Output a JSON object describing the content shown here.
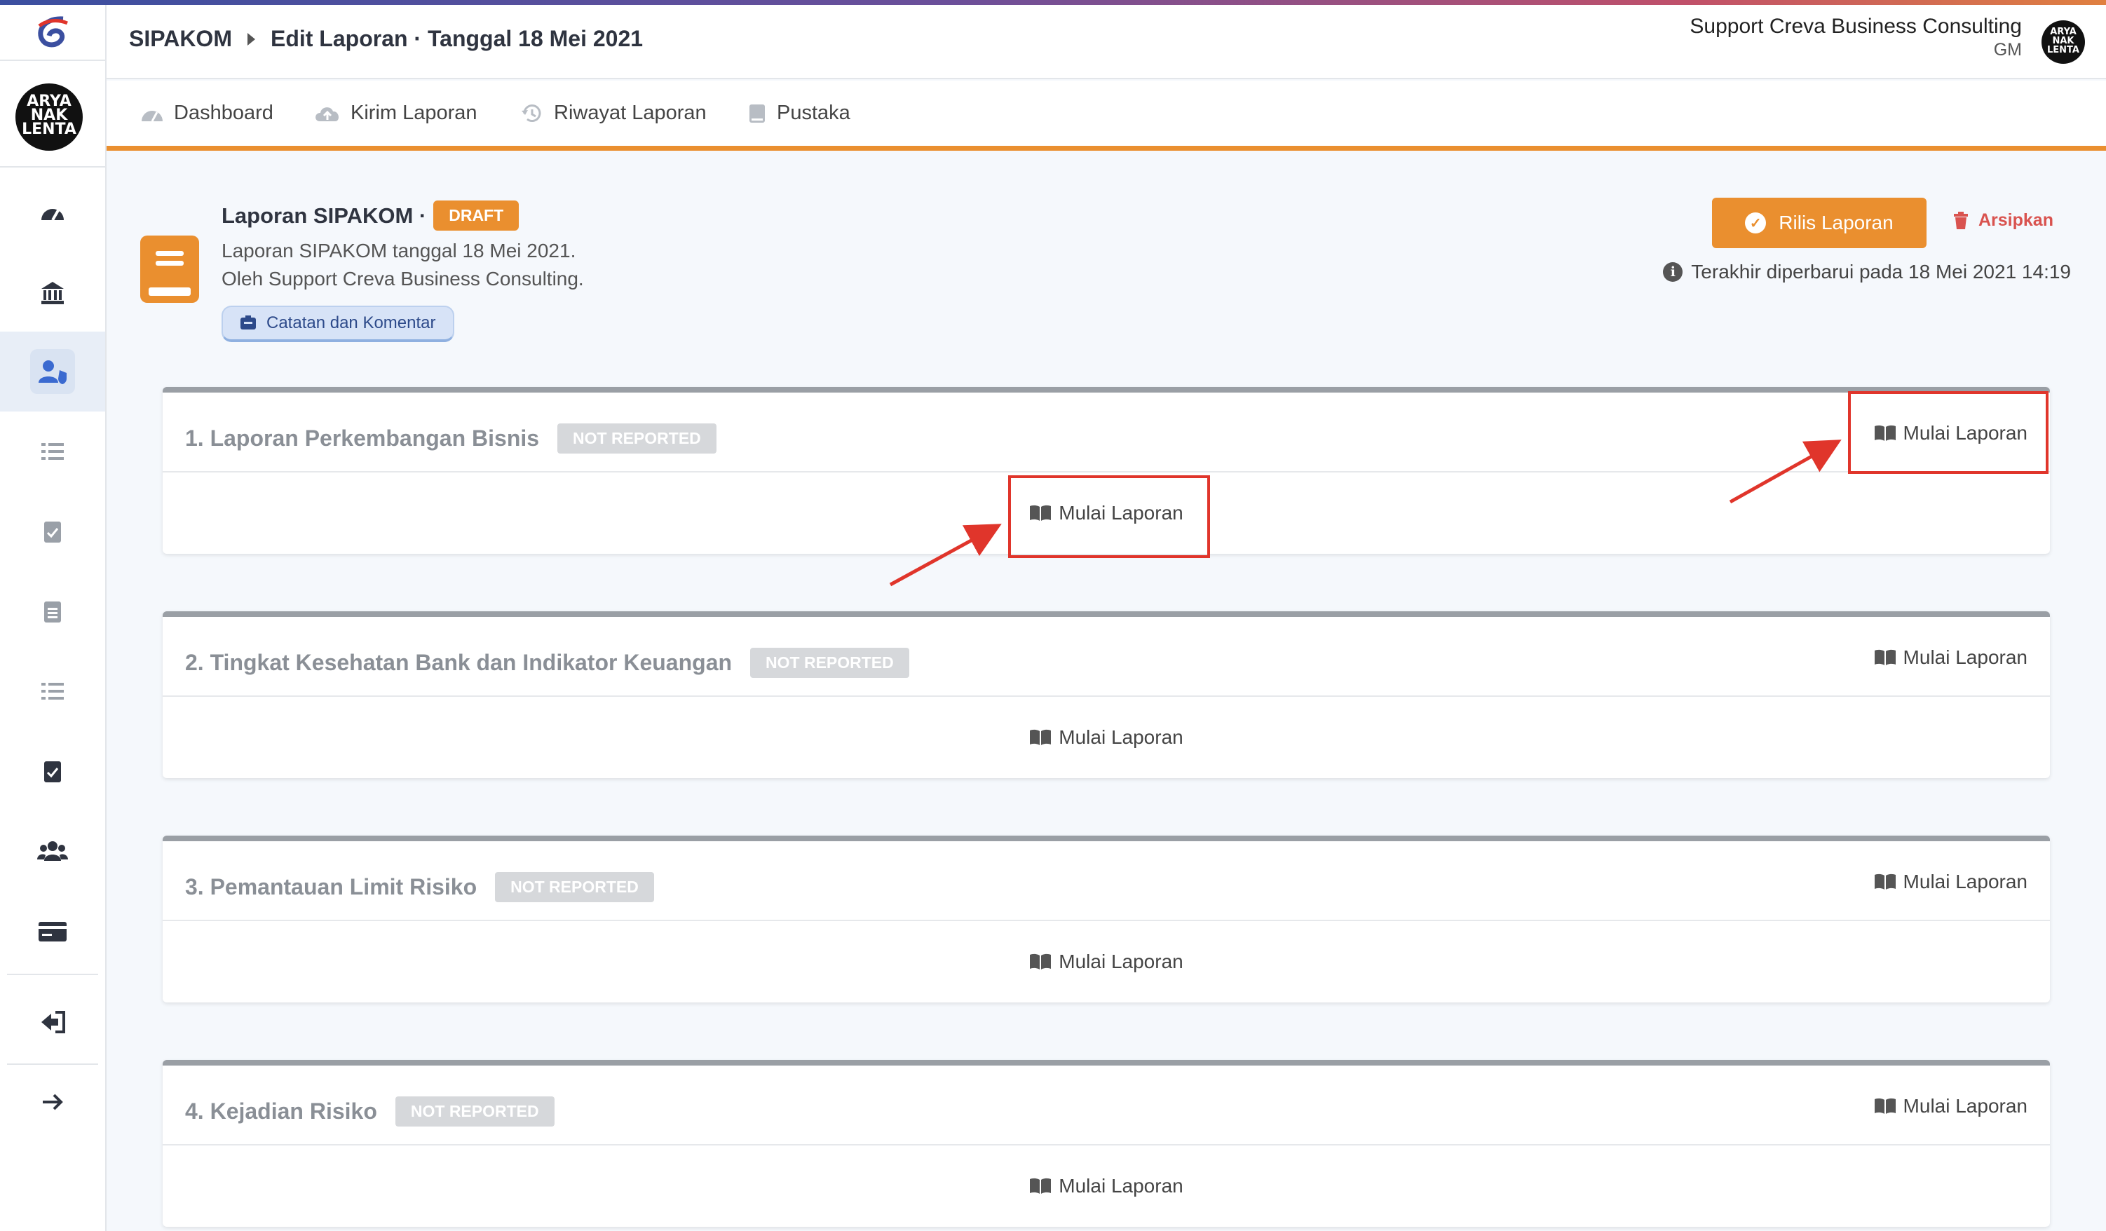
{
  "colors": {
    "accent": "#ea8f2f",
    "danger": "#d9534f",
    "annotation": "#e0352b",
    "badge_muted": "#d6d8db"
  },
  "sidebar": {
    "logo_icon": "app-logo-icon",
    "avatar_text": "ARYA NAK LENTA",
    "items": [
      {
        "name": "dashboard",
        "icon": "tachometer-icon",
        "glyph": "◔"
      },
      {
        "name": "bank",
        "icon": "bank-icon",
        "glyph": "⌂"
      },
      {
        "name": "users",
        "icon": "user-shield-icon",
        "glyph": "●",
        "active": true
      },
      {
        "name": "tasks",
        "icon": "task-list-icon",
        "glyph": "☰"
      },
      {
        "name": "clipboard-check",
        "icon": "clipboard-check-icon",
        "glyph": "✓"
      },
      {
        "name": "clipboard-list",
        "icon": "clipboard-list-icon",
        "glyph": "▤"
      },
      {
        "name": "tasks-2",
        "icon": "task-list-icon",
        "glyph": "☰"
      },
      {
        "name": "clipboard-check-2",
        "icon": "clipboard-check-icon",
        "glyph": "✓"
      },
      {
        "name": "group",
        "icon": "users-group-icon",
        "glyph": "●●"
      },
      {
        "name": "card",
        "icon": "credit-card-icon",
        "glyph": "▭"
      },
      {
        "name": "logout",
        "icon": "sign-out-icon",
        "glyph": "⇦"
      },
      {
        "name": "expand",
        "icon": "arrow-right-icon",
        "glyph": "→"
      }
    ]
  },
  "header": {
    "crumb_root": "SIPAKOM",
    "crumb_page": "Edit Laporan · Tanggal 18 Mei 2021",
    "user_name": "Support Creva Business Consulting",
    "user_role": "GM",
    "user_avatar_text": "ARYA NAK LENTA"
  },
  "tabs": [
    {
      "label": "Dashboard",
      "icon": "dashboard-icon",
      "glyph": "◔"
    },
    {
      "label": "Kirim Laporan",
      "icon": "cloud-upload-icon",
      "glyph": "☁"
    },
    {
      "label": "Riwayat Laporan",
      "icon": "history-icon",
      "glyph": "↺"
    },
    {
      "label": "Pustaka",
      "icon": "book-icon",
      "glyph": "▮"
    }
  ],
  "report": {
    "title": "Laporan SIPAKOM ·",
    "status": "DRAFT",
    "desc_line1": "Laporan SIPAKOM tanggal 18 Mei 2021.",
    "desc_line2": "Oleh Support Creva Business Consulting.",
    "notes_label": "Catatan dan Komentar",
    "release_label": "Rilis Laporan",
    "archive_label": "Arsipkan",
    "updated_text": "Terakhir diperbarui pada 18 Mei 2021 14:19"
  },
  "sections": [
    {
      "title": "1. Laporan Perkembangan Bisnis",
      "status": "NOT REPORTED",
      "head_action": "Mulai Laporan",
      "body_action": "Mulai Laporan"
    },
    {
      "title": "2. Tingkat Kesehatan Bank dan Indikator Keuangan",
      "status": "NOT REPORTED",
      "head_action": "Mulai Laporan",
      "body_action": "Mulai Laporan"
    },
    {
      "title": "3. Pemantauan Limit Risiko",
      "status": "NOT REPORTED",
      "head_action": "Mulai Laporan",
      "body_action": "Mulai Laporan"
    },
    {
      "title": "4. Kejadian Risiko",
      "status": "NOT REPORTED",
      "head_action": "Mulai Laporan",
      "body_action": "Mulai Laporan"
    }
  ]
}
